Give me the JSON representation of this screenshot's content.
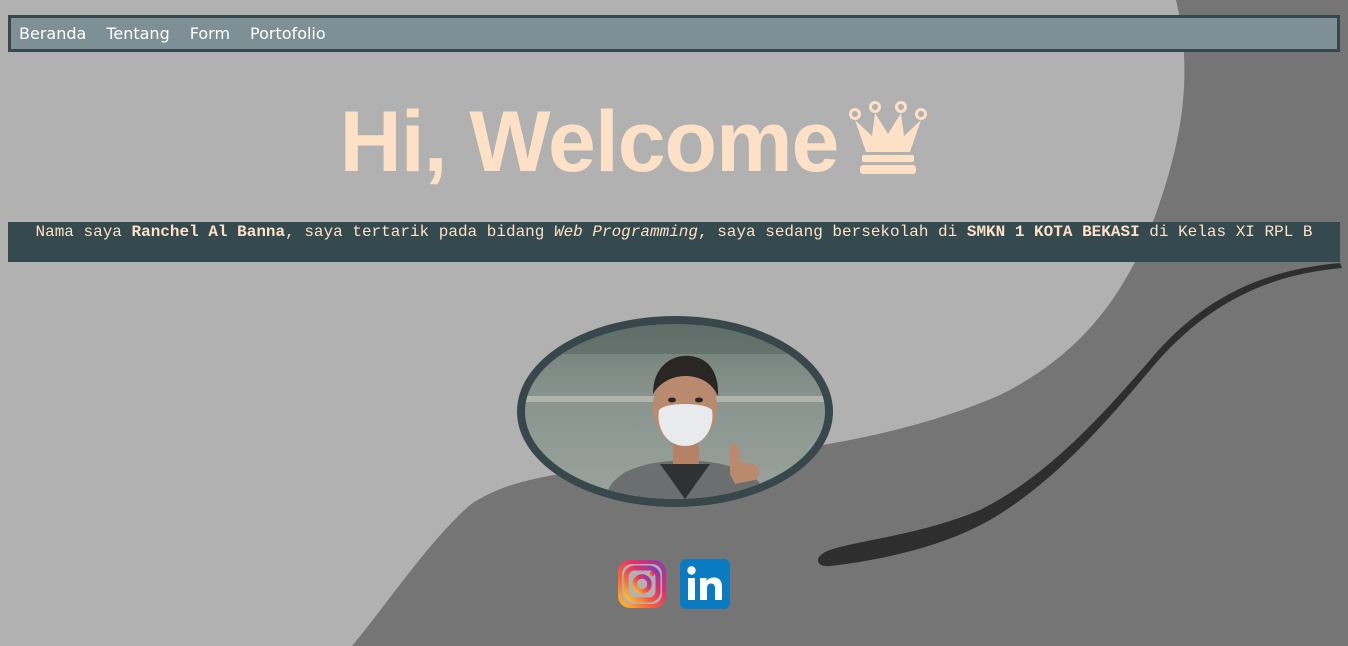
{
  "nav": {
    "items": [
      {
        "label": "Beranda"
      },
      {
        "label": "Tentang"
      },
      {
        "label": "Form"
      },
      {
        "label": "Portofolio"
      }
    ]
  },
  "hero": {
    "title": "Hi, Welcome",
    "icon": "crown-icon"
  },
  "intro": {
    "prefix": "Nama saya ",
    "name": "Ranchel Al Banna",
    "middle": ", saya tertarik pada bidang ",
    "field": "Web Programming",
    "school_prefix": ", saya sedang bersekolah di ",
    "school": "SMKN 1 KOTA BEKASI",
    "suffix": " di Kelas XI RPL B"
  },
  "profile_photo": {
    "alt": "profile-photo"
  },
  "socials": [
    {
      "icon": "instagram-icon"
    },
    {
      "icon": "linkedin-icon"
    }
  ],
  "colors": {
    "background": "#b1b1b1",
    "wave": "#757575",
    "navbar": "#7f8f96",
    "border": "#37474b",
    "accent_text": "#fde1c6",
    "intro_bg": "#354a4e"
  }
}
